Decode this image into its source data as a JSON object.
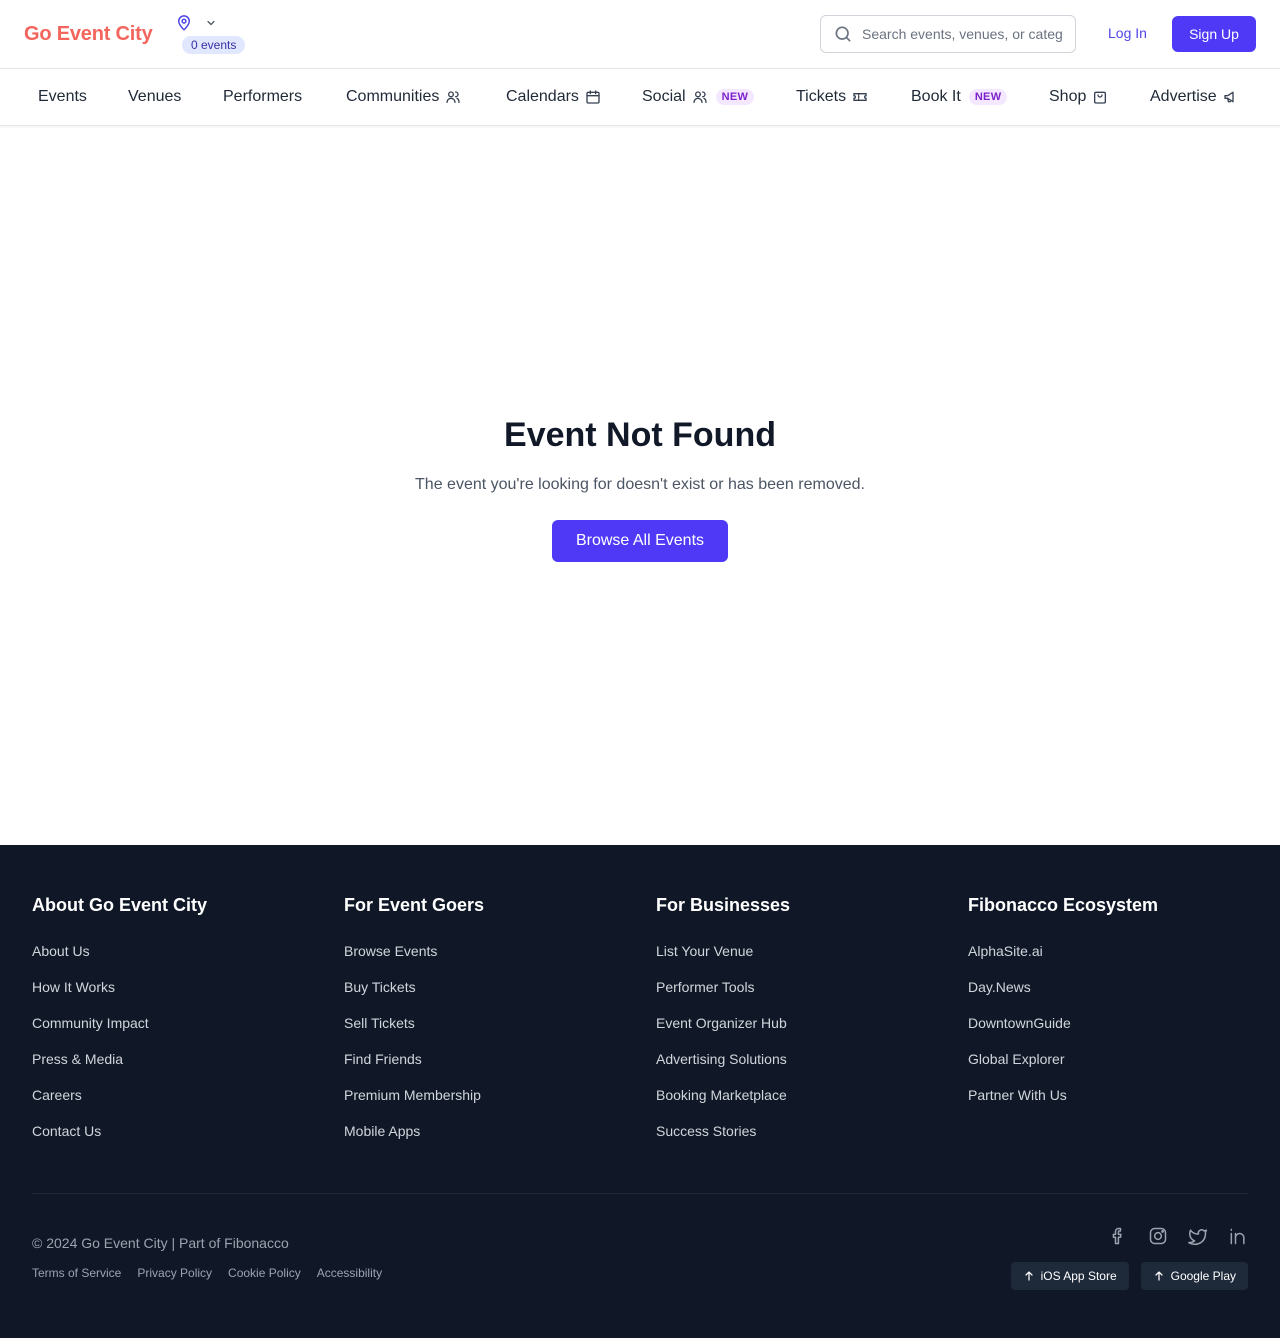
{
  "header": {
    "logo": "Go Event City",
    "location_count": "0 events",
    "search_placeholder": "Search events, venues, or categories",
    "login": "Log In",
    "signup": "Sign Up"
  },
  "nav": {
    "items": [
      {
        "label": "Events"
      },
      {
        "label": "Venues"
      },
      {
        "label": "Performers"
      },
      {
        "label": "Communities",
        "icon": "users-icon"
      },
      {
        "label": "Calendars",
        "icon": "calendar-icon"
      },
      {
        "label": "Social",
        "icon": "users-icon",
        "badge": "NEW"
      },
      {
        "label": "Tickets",
        "icon": "ticket-icon"
      },
      {
        "label": "Book It",
        "badge": "NEW"
      },
      {
        "label": "Shop",
        "icon": "shopping-bag-icon"
      },
      {
        "label": "Advertise",
        "icon": "megaphone-icon"
      }
    ]
  },
  "main": {
    "title": "Event Not Found",
    "message": "The event you're looking for doesn't exist or has been removed.",
    "button": "Browse All Events"
  },
  "footer": {
    "columns": [
      {
        "title": "About Go Event City",
        "links": [
          "About Us",
          "How It Works",
          "Community Impact",
          "Press & Media",
          "Careers",
          "Contact Us"
        ]
      },
      {
        "title": "For Event Goers",
        "links": [
          "Browse Events",
          "Buy Tickets",
          "Sell Tickets",
          "Find Friends",
          "Premium Membership",
          "Mobile Apps"
        ]
      },
      {
        "title": "For Businesses",
        "links": [
          "List Your Venue",
          "Performer Tools",
          "Event Organizer Hub",
          "Advertising Solutions",
          "Booking Marketplace",
          "Success Stories"
        ]
      },
      {
        "title": "Fibonacco Ecosystem",
        "links": [
          "AlphaSite.ai",
          "Day.News",
          "DowntownGuide",
          "Global Explorer",
          "Partner With Us"
        ]
      }
    ],
    "copyright": "© 2024 Go Event City | Part of Fibonacco",
    "legal": [
      "Terms of Service",
      "Privacy Policy",
      "Cookie Policy",
      "Accessibility"
    ],
    "social": [
      "facebook-icon",
      "instagram-icon",
      "twitter-icon",
      "linkedin-icon"
    ],
    "stores": [
      "iOS App Store",
      "Google Play"
    ]
  },
  "colors": {
    "brand": "#f2665e",
    "primary": "#4f39f6",
    "footer_bg": "#101828"
  }
}
